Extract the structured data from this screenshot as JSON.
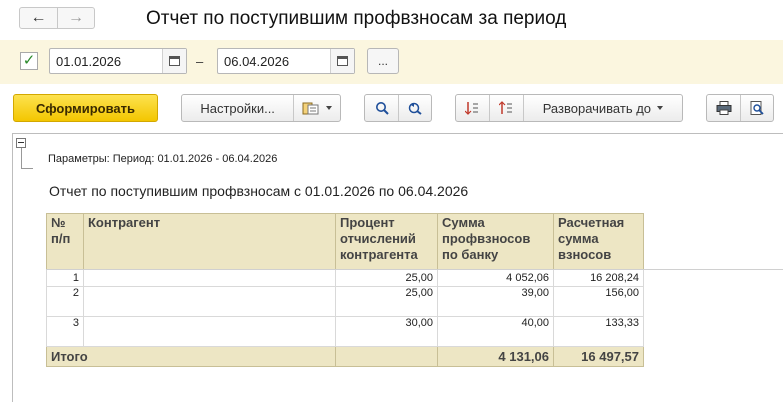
{
  "window": {
    "title": "Отчет по поступившим профвзносам за период",
    "nav": {
      "back_icon": "arrow-left-icon",
      "forward_icon": "arrow-right-icon"
    }
  },
  "params": {
    "period_enabled": true,
    "date_from": "01.01.2026",
    "date_to": "06.04.2026",
    "separator": "–",
    "more_label": "..."
  },
  "toolbar": {
    "generate_label": "Сформировать",
    "settings_label": "Настройки...",
    "expand_label": "Разворачивать до",
    "icons": [
      "variants-icon",
      "search-icon",
      "search-next-icon",
      "collapse-all-icon",
      "expand-all-icon",
      "print-icon",
      "preview-icon"
    ]
  },
  "report": {
    "params_line": "Параметры: Период: 01.01.2026 - 06.04.2026",
    "title": "Отчет по поступившим профвзносам с 01.01.2026 по 06.04.2026",
    "columns": [
      "№ п/п",
      "Контрагент",
      "Процент отчислений контрагента",
      "Сумма профвзносов по банку",
      "Расчетная сумма взносов"
    ],
    "rows": [
      {
        "n": "1",
        "contractor": "",
        "percent": "25,00",
        "bank_sum": "4 052,06",
        "calc_sum": "16 208,24"
      },
      {
        "n": "2",
        "contractor": "",
        "percent": "25,00",
        "bank_sum": "39,00",
        "calc_sum": "156,00"
      },
      {
        "n": "3",
        "contractor": "",
        "percent": "30,00",
        "bank_sum": "40,00",
        "calc_sum": "133,33"
      }
    ],
    "total": {
      "label": "Итого",
      "bank_sum": "4 131,06",
      "calc_sum": "16 497,57"
    }
  },
  "colors": {
    "accent_button": "#f3c600",
    "param_bg": "#fbf6df",
    "table_header_bg": "#ede6c4"
  }
}
